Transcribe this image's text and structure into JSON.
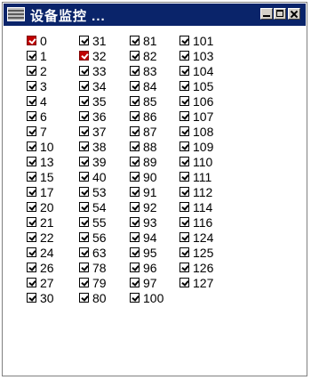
{
  "window": {
    "title": "设备监控 ..."
  },
  "columns": [
    [
      {
        "label": "0",
        "color": "#c00000"
      },
      {
        "label": "1"
      },
      {
        "label": "2"
      },
      {
        "label": "3"
      },
      {
        "label": "4"
      },
      {
        "label": "6"
      },
      {
        "label": "7"
      },
      {
        "label": "10"
      },
      {
        "label": "13"
      },
      {
        "label": "15"
      },
      {
        "label": "17"
      },
      {
        "label": "20"
      },
      {
        "label": "21"
      },
      {
        "label": "22"
      },
      {
        "label": "24"
      },
      {
        "label": "26"
      },
      {
        "label": "27"
      },
      {
        "label": "30"
      }
    ],
    [
      {
        "label": "31"
      },
      {
        "label": "32",
        "color": "#c00000"
      },
      {
        "label": "33"
      },
      {
        "label": "34"
      },
      {
        "label": "35"
      },
      {
        "label": "36"
      },
      {
        "label": "37"
      },
      {
        "label": "38"
      },
      {
        "label": "39"
      },
      {
        "label": "40"
      },
      {
        "label": "53"
      },
      {
        "label": "54"
      },
      {
        "label": "55"
      },
      {
        "label": "56"
      },
      {
        "label": "63"
      },
      {
        "label": "78"
      },
      {
        "label": "79"
      },
      {
        "label": "80"
      }
    ],
    [
      {
        "label": "81"
      },
      {
        "label": "82"
      },
      {
        "label": "83"
      },
      {
        "label": "84"
      },
      {
        "label": "85"
      },
      {
        "label": "86"
      },
      {
        "label": "87"
      },
      {
        "label": "88"
      },
      {
        "label": "89"
      },
      {
        "label": "90"
      },
      {
        "label": "91"
      },
      {
        "label": "92"
      },
      {
        "label": "93"
      },
      {
        "label": "94"
      },
      {
        "label": "95"
      },
      {
        "label": "96"
      },
      {
        "label": "97"
      },
      {
        "label": "100"
      }
    ],
    [
      {
        "label": "101"
      },
      {
        "label": "103"
      },
      {
        "label": "104"
      },
      {
        "label": "105"
      },
      {
        "label": "106"
      },
      {
        "label": "107"
      },
      {
        "label": "108"
      },
      {
        "label": "109"
      },
      {
        "label": "110"
      },
      {
        "label": "111"
      },
      {
        "label": "112"
      },
      {
        "label": "114"
      },
      {
        "label": "116"
      },
      {
        "label": "124"
      },
      {
        "label": "125"
      },
      {
        "label": "126"
      },
      {
        "label": "127"
      }
    ]
  ]
}
